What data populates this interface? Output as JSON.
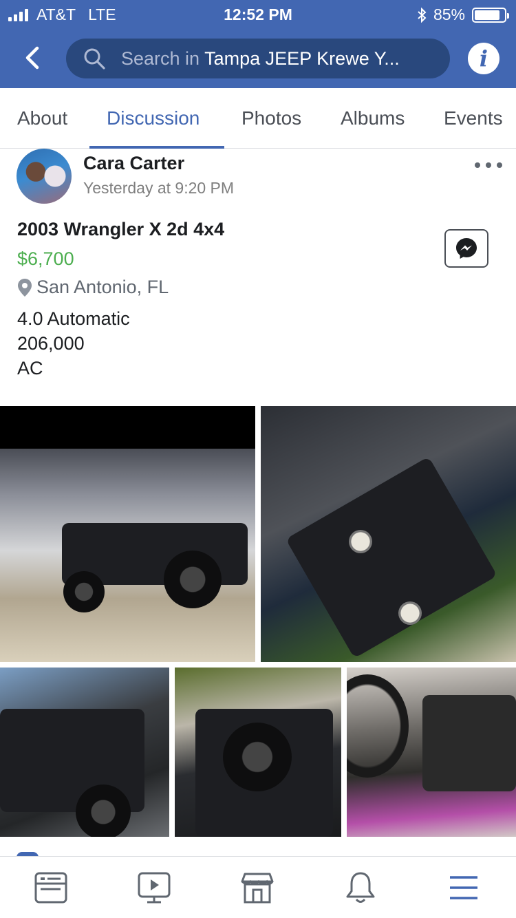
{
  "status_bar": {
    "carrier": "AT&T",
    "network": "LTE",
    "time": "12:52 PM",
    "bluetooth_icon": "bluetooth-icon",
    "battery_percent": "85%",
    "battery_level": 0.85
  },
  "header": {
    "back_icon": "chevron-left-icon",
    "search_prefix": "Search in",
    "search_group": "Tampa JEEP Krewe Y...",
    "info_icon": "info-icon",
    "info_glyph": "i"
  },
  "tabs": [
    {
      "label": "About",
      "active": false
    },
    {
      "label": "Discussion",
      "active": true
    },
    {
      "label": "Photos",
      "active": false
    },
    {
      "label": "Albums",
      "active": false
    },
    {
      "label": "Events",
      "active": false
    }
  ],
  "post": {
    "author": "Cara Carter",
    "timestamp": "Yesterday at 9:20 PM",
    "item_title": "2003 Wrangler X 2d 4x4",
    "price": "$6,700",
    "location": "San Antonio, FL",
    "description_lines": [
      "4.0 Automatic",
      "206,000",
      "AC"
    ],
    "photo_count_shown": 5
  },
  "bottom_nav": [
    {
      "icon": "news-feed-icon",
      "active": false
    },
    {
      "icon": "watch-video-icon",
      "active": false
    },
    {
      "icon": "marketplace-icon",
      "active": false
    },
    {
      "icon": "notifications-bell-icon",
      "active": false
    },
    {
      "icon": "menu-icon",
      "active": true
    }
  ],
  "colors": {
    "brand_blue": "#4267b2",
    "search_bg": "#29487d",
    "price_green": "#4cae4f",
    "muted_text": "#606770"
  }
}
